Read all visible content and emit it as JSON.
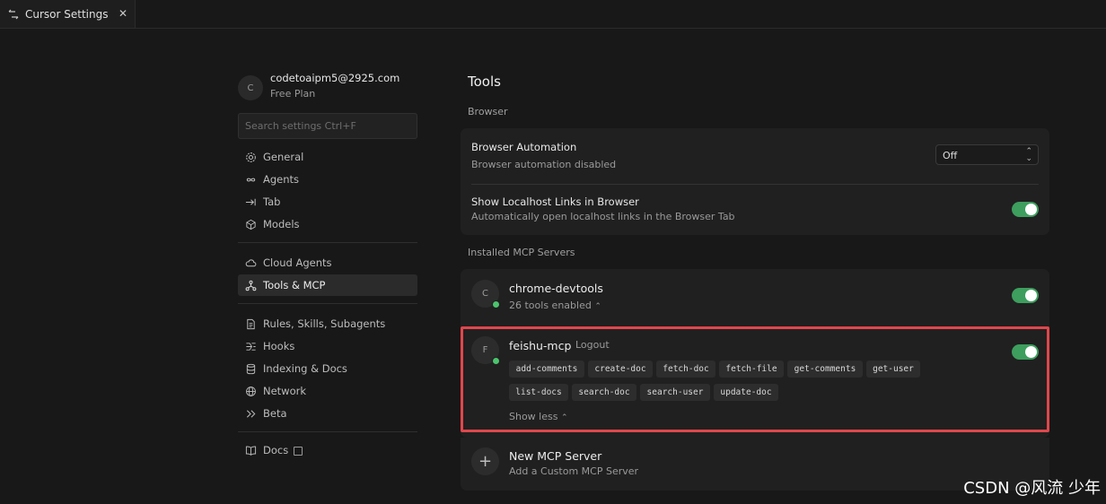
{
  "tab": {
    "title": "Cursor Settings",
    "close": "✕"
  },
  "account": {
    "avatar_letter": "C",
    "email": "codetoaipm5@2925.com",
    "plan": "Free Plan"
  },
  "search": {
    "placeholder": "Search settings Ctrl+F"
  },
  "sidebar": {
    "group1": [
      {
        "label": "General",
        "icon": "gear-icon"
      },
      {
        "label": "Agents",
        "icon": "infinity-icon"
      },
      {
        "label": "Tab",
        "icon": "tab-arrow-icon"
      },
      {
        "label": "Models",
        "icon": "cube-icon"
      }
    ],
    "group2": [
      {
        "label": "Cloud Agents",
        "icon": "cloud-icon"
      },
      {
        "label": "Tools & MCP",
        "icon": "tools-network-icon",
        "active": true
      }
    ],
    "group3": [
      {
        "label": "Rules, Skills, Subagents",
        "icon": "document-icon"
      },
      {
        "label": "Hooks",
        "icon": "hooks-icon"
      },
      {
        "label": "Indexing & Docs",
        "icon": "database-icon"
      },
      {
        "label": "Network",
        "icon": "globe-icon"
      },
      {
        "label": "Beta",
        "icon": "double-chevron-icon"
      }
    ],
    "docs": {
      "label": "Docs",
      "icon": "book-icon"
    }
  },
  "main": {
    "title": "Tools",
    "browser_section": "Browser",
    "browser_automation": {
      "title": "Browser Automation",
      "subtitle": "Browser automation disabled",
      "select_value": "Off"
    },
    "localhost_links": {
      "title": "Show Localhost Links in Browser",
      "subtitle": "Automatically open localhost links in the Browser Tab",
      "enabled": true
    },
    "mcp_section": "Installed MCP Servers",
    "servers": [
      {
        "letter": "C",
        "name": "chrome-devtools",
        "meta": "26 tools enabled",
        "enabled": true,
        "status_color": "#4cc46e"
      },
      {
        "letter": "F",
        "name": "feishu-mcp",
        "action": "Logout",
        "enabled": true,
        "status_color": "#4cc46e",
        "tools": [
          "add-comments",
          "create-doc",
          "fetch-doc",
          "fetch-file",
          "get-comments",
          "get-user",
          "list-docs",
          "search-doc",
          "search-user",
          "update-doc"
        ],
        "show_less": "Show less"
      }
    ],
    "new_server": {
      "title": "New MCP Server",
      "subtitle": "Add a Custom MCP Server"
    }
  },
  "colors": {
    "accent_toggle": "#3d9e5e",
    "highlight_border": "#e0474c",
    "background": "#181818"
  },
  "watermark": "CSDN @风流 少年"
}
